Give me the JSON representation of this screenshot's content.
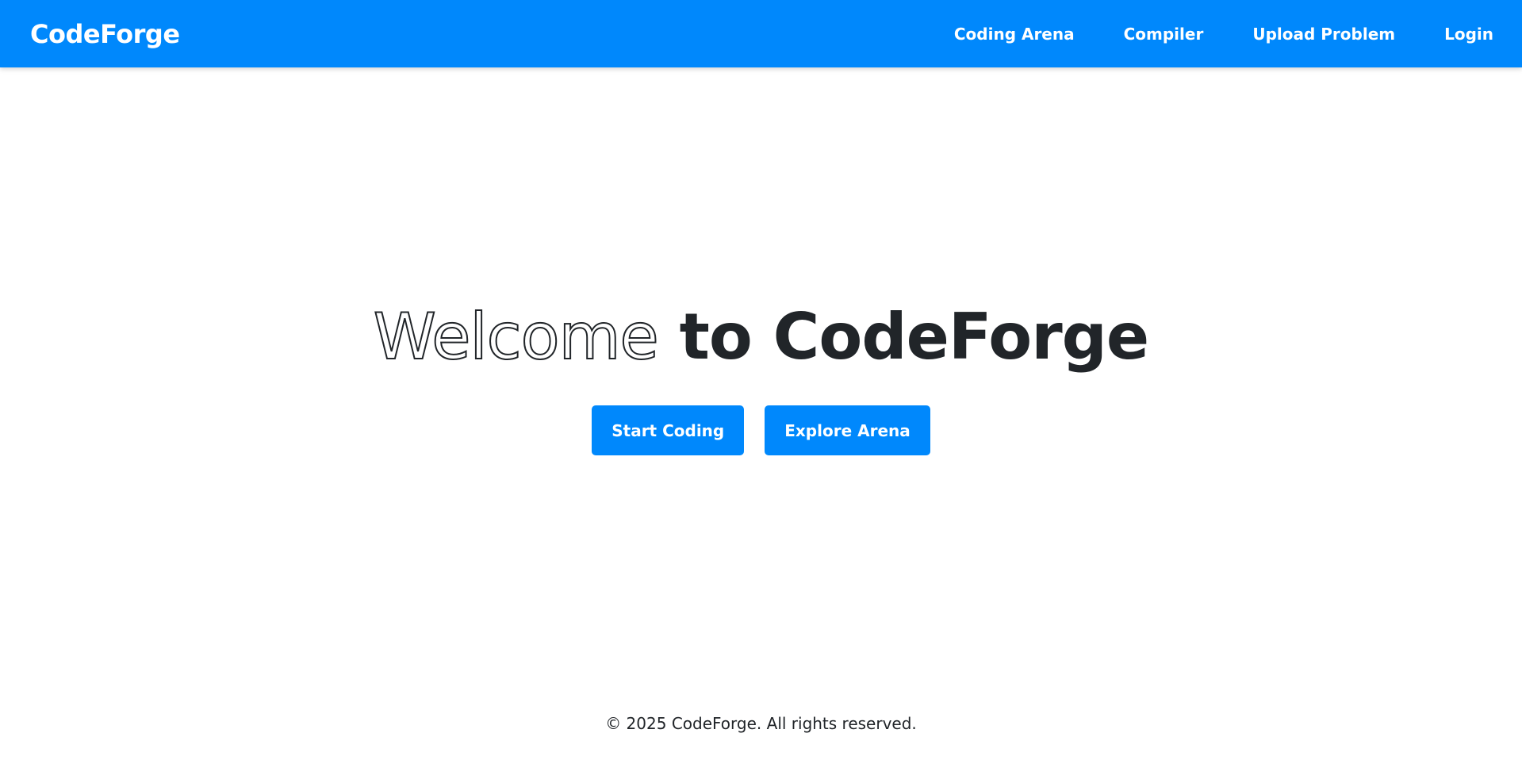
{
  "navbar": {
    "brand": "CodeForge",
    "links": [
      "Coding Arena",
      "Compiler",
      "Upload Problem",
      "Login"
    ]
  },
  "hero": {
    "title_outline": "Welcome",
    "title_rest": " to CodeForge",
    "buttons": [
      "Start Coding",
      "Explore Arena"
    ]
  },
  "footer": {
    "text": "© 2025 CodeForge. All rights reserved."
  },
  "colors": {
    "primary": "#0088fc",
    "text": "#212529",
    "background": "#ffffff"
  }
}
